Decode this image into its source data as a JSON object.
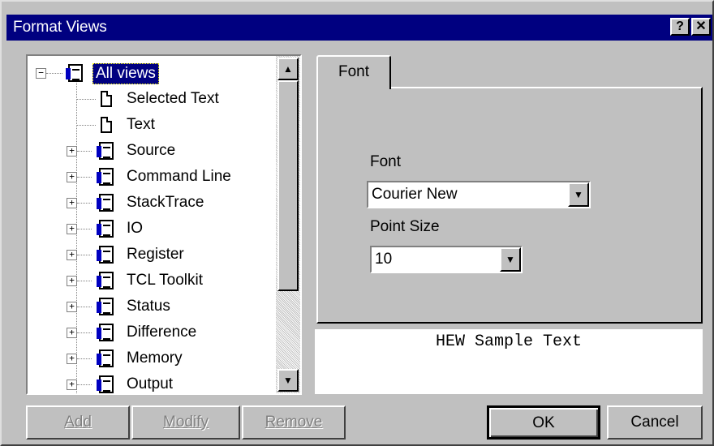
{
  "window": {
    "title": "Format Views",
    "help_glyph": "?",
    "close_glyph": "✕"
  },
  "tree": {
    "items": [
      {
        "label": "All views",
        "expander": "−"
      },
      {
        "label": "Selected Text"
      },
      {
        "label": "Text"
      },
      {
        "label": "Source",
        "expander": "+"
      },
      {
        "label": "Command Line",
        "expander": "+"
      },
      {
        "label": "StackTrace",
        "expander": "+"
      },
      {
        "label": "IO",
        "expander": "+"
      },
      {
        "label": "Register",
        "expander": "+"
      },
      {
        "label": "TCL Toolkit",
        "expander": "+"
      },
      {
        "label": "Status",
        "expander": "+"
      },
      {
        "label": "Difference",
        "expander": "+"
      },
      {
        "label": "Memory",
        "expander": "+"
      },
      {
        "label": "Output",
        "expander": "+"
      }
    ],
    "scroll_up_glyph": "▲",
    "scroll_down_glyph": "▼"
  },
  "tab": {
    "label": "Font"
  },
  "font": {
    "label": "Font",
    "value": "Courier New"
  },
  "point_size": {
    "label": "Point Size",
    "value": "10"
  },
  "dropdown_glyph": "▼",
  "sample": {
    "text": "HEW Sample Text"
  },
  "buttons": {
    "add": "Add",
    "modify": "Modify",
    "remove": "Remove",
    "ok": "OK",
    "cancel": "Cancel"
  }
}
